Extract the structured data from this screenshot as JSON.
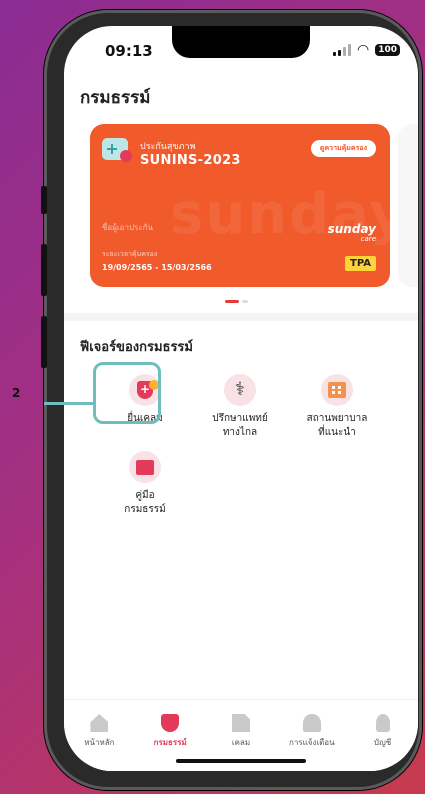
{
  "status_bar": {
    "time": "09:13",
    "battery": "100"
  },
  "page": {
    "title": "กรมธรรม์"
  },
  "policy_card": {
    "type_label": "ประกันสุขภาพ",
    "policy_name": "SUNINS-2023",
    "coverage_button": "ดูความคุ้มครอง",
    "watermark": "sunday",
    "insured_label": "ชื่อผู้เอาประกัน",
    "period_label": "ระยะเวลาคุ้มครอง",
    "period_value": "19/09/2565 - 15/03/2566",
    "brand_main": "sunday",
    "brand_sub": "care",
    "tpa_badge": "TPA",
    "colors": {
      "card": "#f15a2b",
      "tpa": "#ffd23a"
    }
  },
  "features": {
    "section_title": "ฟีเจอร์ของกรมธรรม์",
    "items": [
      {
        "label_line1": "ยื่นเคลม",
        "label_line2": "",
        "icon": "claim-shield-icon"
      },
      {
        "label_line1": "ปรึกษาแพทย์",
        "label_line2": "ทางไกล",
        "icon": "stethoscope-icon"
      },
      {
        "label_line1": "สถานพยาบาล",
        "label_line2": "ที่แนะนำ",
        "icon": "hospital-icon"
      },
      {
        "label_line1": "คู่มือ",
        "label_line2": "กรมธรรม์",
        "icon": "book-icon"
      }
    ]
  },
  "annotation": {
    "step_number": "2",
    "color": "#6fbdbd"
  },
  "tabbar": {
    "items": [
      {
        "label": "หน้าหลัก",
        "icon": "home-icon",
        "active": false
      },
      {
        "label": "กรมธรรม์",
        "icon": "shield-icon",
        "active": true
      },
      {
        "label": "เคลม",
        "icon": "document-icon",
        "active": false
      },
      {
        "label": "การแจ้งเตือน",
        "icon": "bell-icon",
        "active": false
      },
      {
        "label": "บัญชี",
        "icon": "user-icon",
        "active": false
      }
    ],
    "active_color": "#e43a5a"
  }
}
